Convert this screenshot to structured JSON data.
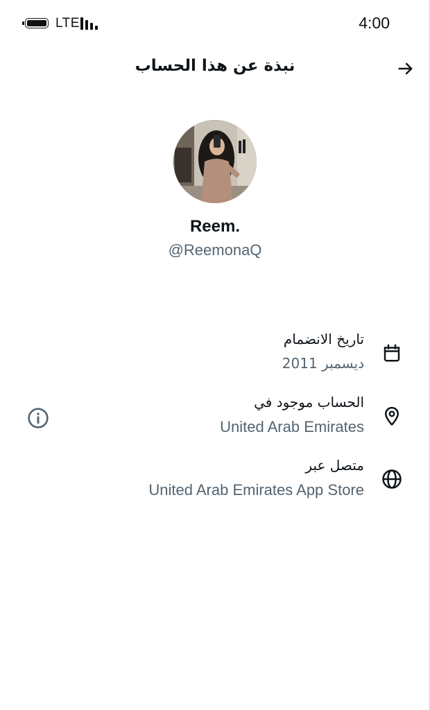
{
  "status_bar": {
    "network": "LTE",
    "time": "4:00"
  },
  "header": {
    "title": "نبذة عن هذا الحساب",
    "back_icon": "arrow-right-icon"
  },
  "profile": {
    "display_name": "Reem.",
    "handle": "@ReemonaQ",
    "avatar_icon": "profile-photo"
  },
  "details": {
    "joined": {
      "title": "تاريخ الانضمام",
      "value": "ديسمبر 2011",
      "icon": "calendar-icon"
    },
    "location": {
      "title": "الحساب موجود في",
      "value": "United Arab Emirates",
      "icon": "location-pin-icon",
      "info_icon": "info-icon"
    },
    "connected_via": {
      "title": "متصل عبر",
      "value": "United Arab Emirates App Store",
      "icon": "globe-icon"
    }
  },
  "colors": {
    "text_primary": "#0f1419",
    "text_secondary": "#536471",
    "background": "#ffffff"
  }
}
